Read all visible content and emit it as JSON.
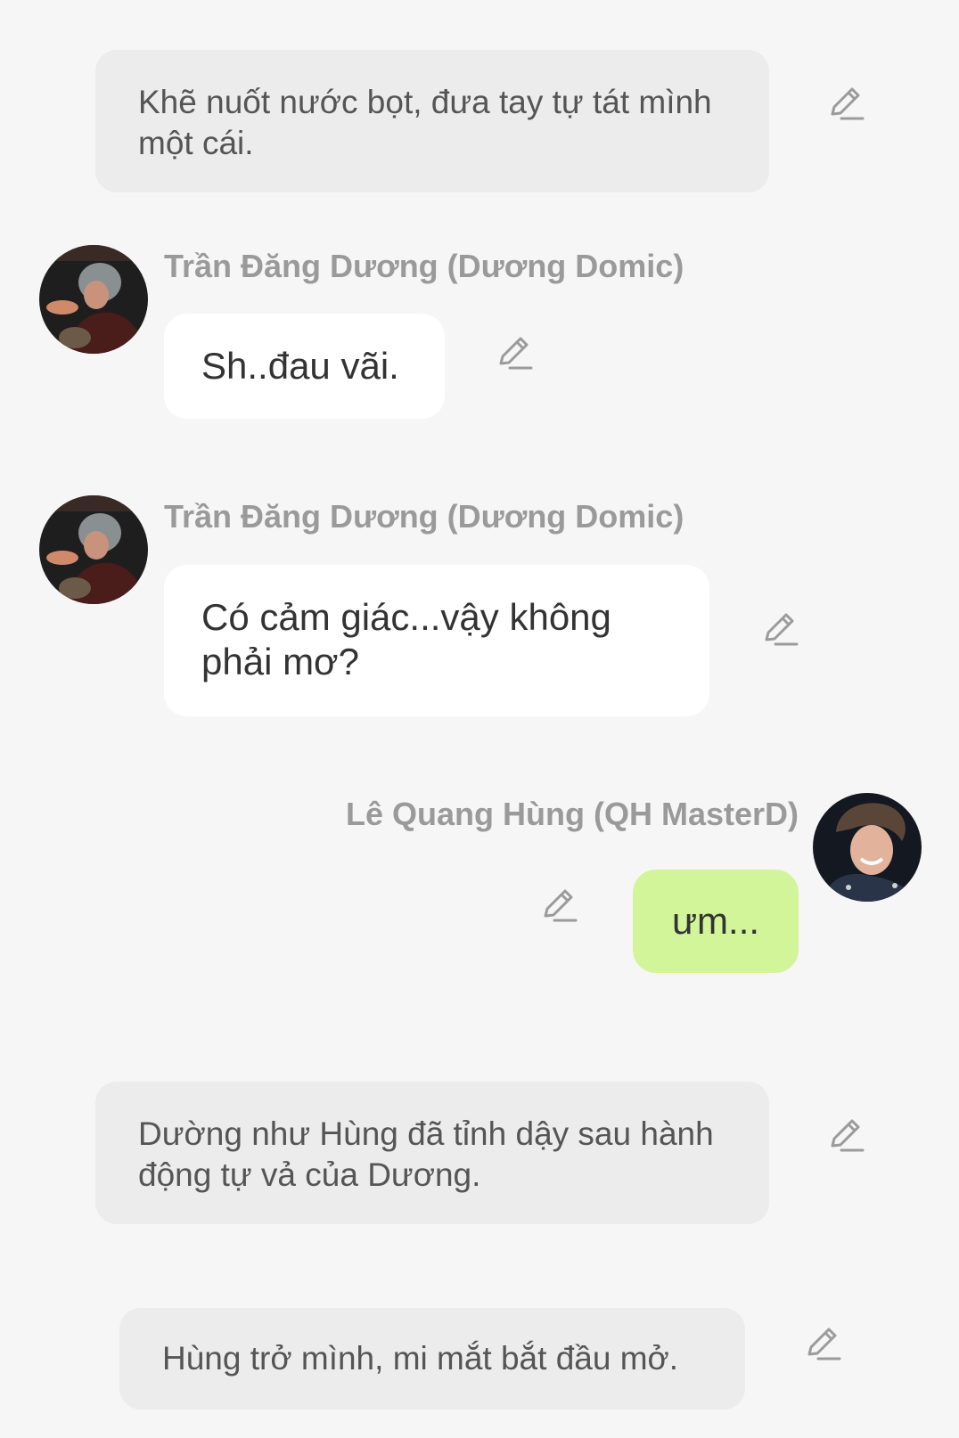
{
  "messages": {
    "narration_1": {
      "text": "Khẽ nuốt nước bọt, đưa tay tự tát mình một cái."
    },
    "duong_1": {
      "sender": "Trần Đăng Dương (Dương Domic)",
      "text": "Sh..đau vãi."
    },
    "duong_2": {
      "sender": "Trần Đăng Dương (Dương Domic)",
      "text": "Có cảm giác...vậy không phải mơ?"
    },
    "hung_1": {
      "sender": "Lê Quang Hùng (QH MasterD)",
      "text": "ưm..."
    },
    "narration_2": {
      "text": "Dường như Hùng đã tỉnh dậy sau hành động tự vả của Dương."
    },
    "narration_3": {
      "text": "Hùng trở mình, mi mắt bắt đầu mở."
    }
  },
  "icons": {
    "edit": "pencil-edit-icon"
  },
  "colors": {
    "background": "#f6f6f6",
    "narration_bubble": "#ececec",
    "incoming_bubble": "#ffffff",
    "outgoing_bubble": "#d3f59a",
    "sender_name": "#9a9a9a",
    "icon": "#9b9b9b"
  }
}
